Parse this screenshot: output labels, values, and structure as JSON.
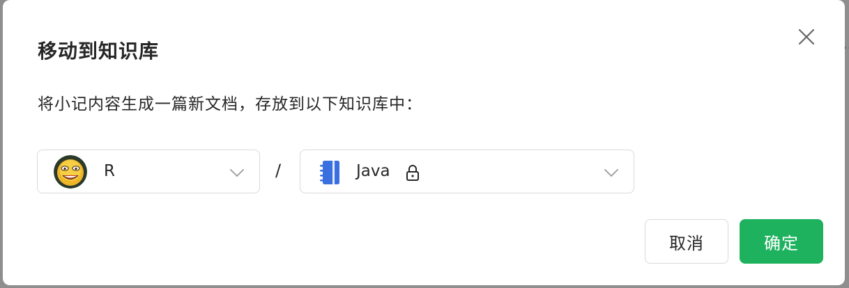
{
  "dialog": {
    "title": "移动到知识库",
    "description": "将小记内容生成一篇新文档，存放到以下知识库中：",
    "close_icon": "close-icon"
  },
  "user_select": {
    "name": "R",
    "avatar_icon": "smiley-avatar",
    "chevron_icon": "chevron-down-icon"
  },
  "separator": "/",
  "book_select": {
    "name": "Java",
    "book_icon": "book-icon",
    "lock_icon": "lock-icon",
    "chevron_icon": "chevron-down-icon"
  },
  "buttons": {
    "cancel": "取消",
    "confirm": "确定"
  },
  "colors": {
    "primary": "#1eb25e",
    "book_icon": "#3a6fe0",
    "border": "#d9d9d9"
  }
}
